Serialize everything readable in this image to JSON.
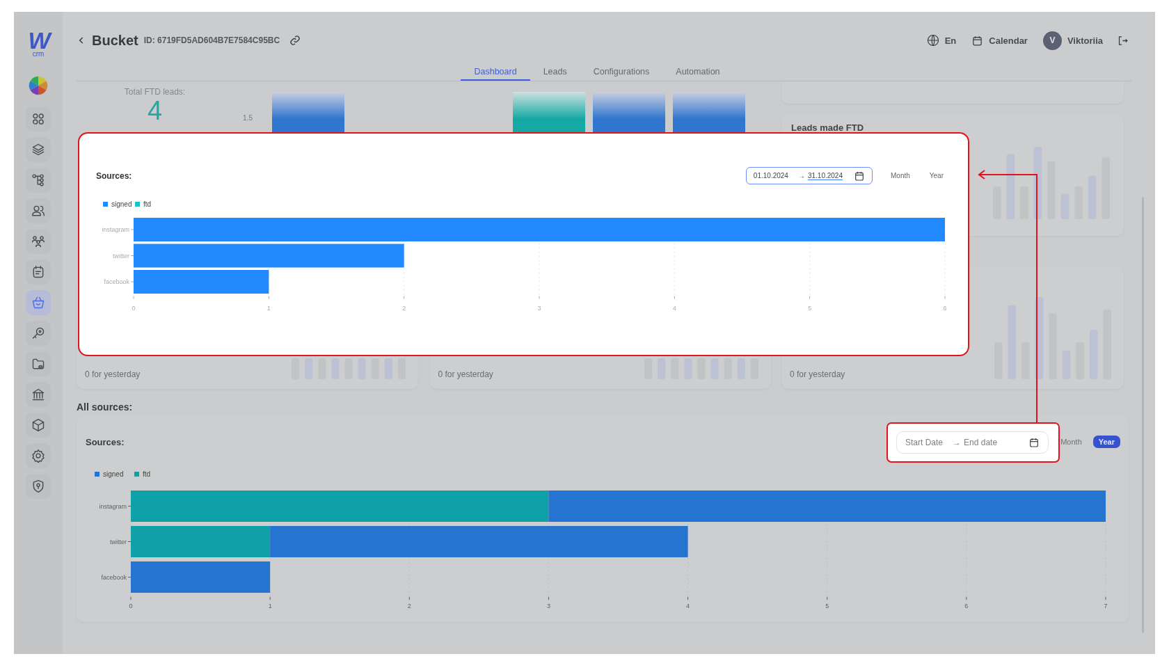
{
  "sidebar": {
    "logo": {
      "mark": "W",
      "caption": "crm"
    },
    "items": [
      {
        "kind": "pie",
        "selected": false
      },
      {
        "kind": "grid",
        "selected": false
      },
      {
        "kind": "layers",
        "selected": false
      },
      {
        "kind": "hierarchy",
        "selected": false
      },
      {
        "kind": "users",
        "selected": false
      },
      {
        "kind": "team",
        "selected": false
      },
      {
        "kind": "note",
        "selected": false
      },
      {
        "kind": "basket",
        "selected": true
      },
      {
        "kind": "key",
        "selected": false
      },
      {
        "kind": "folder",
        "selected": false
      },
      {
        "kind": "bank",
        "selected": false
      },
      {
        "kind": "cube",
        "selected": false
      },
      {
        "kind": "settings",
        "selected": false
      },
      {
        "kind": "shield",
        "selected": false
      }
    ]
  },
  "header": {
    "title": "Bucket",
    "id": "ID: 6719FD5AD604B7E7584C95BC",
    "language": "En",
    "calendar": "Calendar",
    "user": {
      "initial": "V",
      "name": "Viktoriia"
    }
  },
  "tabs": [
    {
      "label": "Dashboard",
      "selected": true
    },
    {
      "label": "Leads",
      "selected": false
    },
    {
      "label": "Configurations",
      "selected": false
    },
    {
      "label": "Automation",
      "selected": false
    }
  ],
  "stats": {
    "total_ftd": {
      "label": "Total FTD leads:",
      "value": "4"
    },
    "chart_tick": "1.5",
    "leads_made_ftd": {
      "title": "Leads made FTD"
    },
    "yesterday": [
      "0 for yesterday",
      "0 for yesterday",
      "0 for yesterday"
    ]
  },
  "popup": {
    "title": "Sources:",
    "date_range": {
      "start": "01.10.2024",
      "arrow": "→",
      "end": "31.10.2024"
    },
    "periods": [
      {
        "label": "Month",
        "selected": false
      },
      {
        "label": "Year",
        "selected": false
      }
    ],
    "chart_data": {
      "type": "bar",
      "orientation": "horizontal",
      "stacked": true,
      "grid": true,
      "legend": "top-left",
      "categories": [
        "instagram",
        "twitter",
        "facebook"
      ],
      "series": [
        {
          "name": "ftd",
          "color": "#1ec2bc",
          "values": [
            0,
            0,
            0
          ]
        },
        {
          "name": "signed",
          "color": "#2389ff",
          "values": [
            6,
            2,
            1
          ]
        }
      ],
      "xlim": [
        0,
        6
      ],
      "xticks": [
        0,
        1,
        2,
        3,
        4,
        5,
        6
      ]
    }
  },
  "all_sources": {
    "heading": "All sources:",
    "card": {
      "title": "Sources:",
      "date_range": {
        "start_placeholder": "Start Date",
        "arrow": "→",
        "end_placeholder": "End date"
      },
      "periods": [
        {
          "label": "Month",
          "selected": false
        },
        {
          "label": "Year",
          "selected": true
        }
      ],
      "chart_data": {
        "type": "bar",
        "orientation": "horizontal",
        "stacked": true,
        "grid": true,
        "legend": "top-left",
        "categories": [
          "instagram",
          "twitter",
          "facebook"
        ],
        "series": [
          {
            "name": "ftd",
            "color": "#0fa0a8",
            "values": [
              3,
              1,
              0
            ]
          },
          {
            "name": "signed",
            "color": "#2474d0",
            "values": [
              4,
              3,
              1
            ]
          }
        ],
        "xlim": [
          0,
          7
        ],
        "xticks": [
          0,
          1,
          2,
          3,
          4,
          5,
          6,
          7
        ]
      }
    }
  }
}
